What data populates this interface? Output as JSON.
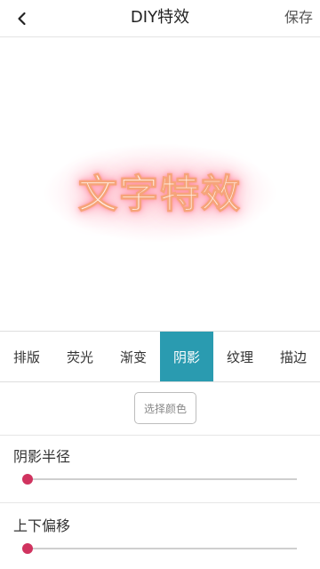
{
  "header": {
    "back_icon": "chevron-left-icon",
    "title": "DIY特效",
    "save_label": "保存"
  },
  "preview": {
    "text": "文字特效"
  },
  "tabs": [
    {
      "label": "排版",
      "active": false
    },
    {
      "label": "荧光",
      "active": false
    },
    {
      "label": "渐变",
      "active": false
    },
    {
      "label": "阴影",
      "active": true
    },
    {
      "label": "纹理",
      "active": false
    },
    {
      "label": "描边",
      "active": false
    }
  ],
  "color_button": {
    "label": "选择颜色"
  },
  "sliders": [
    {
      "label": "阴影半径",
      "value": 0.0
    },
    {
      "label": "上下偏移",
      "value": 0.0
    }
  ],
  "colors": {
    "accent": "#2a9bb0",
    "thumb": "#d0335f"
  }
}
